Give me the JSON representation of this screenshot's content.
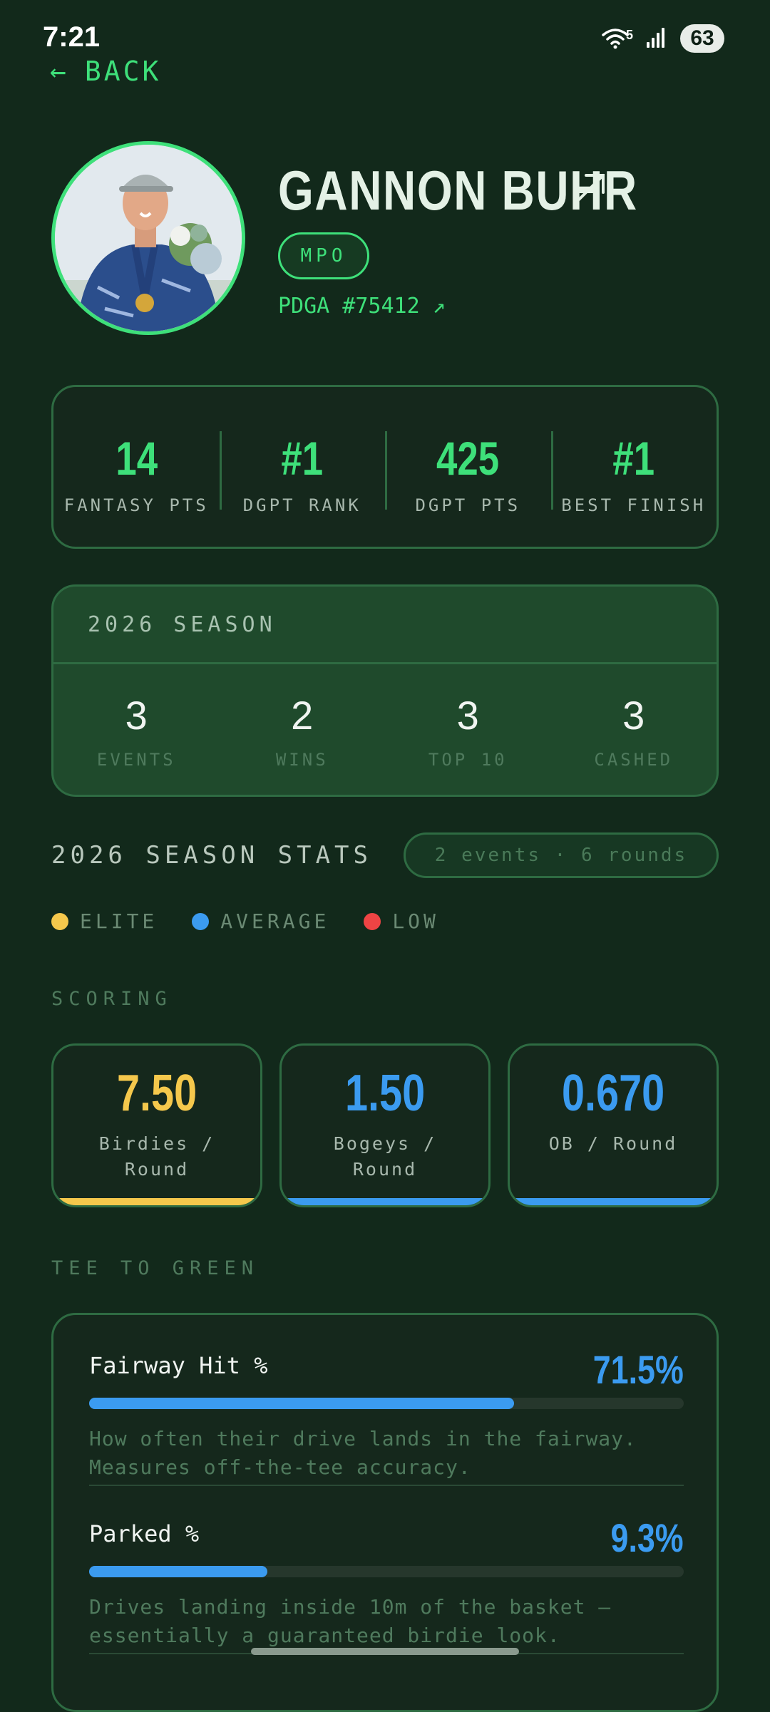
{
  "status_bar": {
    "time": "7:21",
    "wifi_badge": "5",
    "battery": "63"
  },
  "nav": {
    "back_label": "BACK"
  },
  "player": {
    "name": "GANNON BUHR",
    "division": "MPO",
    "pdga": "PDGA #75412 ↗",
    "name_link_icon": "arrow-up-right-icon"
  },
  "top_stats": [
    {
      "value": "14",
      "label": "FANTASY PTS"
    },
    {
      "value": "#1",
      "label": "DGPT RANK"
    },
    {
      "value": "425",
      "label": "DGPT PTS"
    },
    {
      "value": "#1",
      "label": "BEST FINISH"
    }
  ],
  "season": {
    "title": "2026 SEASON",
    "items": [
      {
        "value": "3",
        "label": "EVENTS"
      },
      {
        "value": "2",
        "label": "WINS"
      },
      {
        "value": "3",
        "label": "TOP 10"
      },
      {
        "value": "3",
        "label": "CASHED"
      }
    ]
  },
  "season_stats": {
    "title": "2026 SEASON STATS",
    "pill": "2 events · 6 rounds",
    "legend": [
      {
        "label": "ELITE",
        "color": "#f5c84c"
      },
      {
        "label": "AVERAGE",
        "color": "#3b9bf0"
      },
      {
        "label": "LOW",
        "color": "#ef4444"
      }
    ]
  },
  "scoring": {
    "title": "SCORING",
    "cards": [
      {
        "value": "7.50",
        "label": "Birdies / Round",
        "color": "#f5c84c"
      },
      {
        "value": "1.50",
        "label": "Bogeys / Round",
        "color": "#3b9bf0"
      },
      {
        "value": "0.670",
        "label": "OB / Round",
        "color": "#3b9bf0"
      }
    ]
  },
  "tee_to_green": {
    "title": "TEE TO GREEN",
    "metrics": [
      {
        "label": "Fairway Hit %",
        "value": "71.5%",
        "fill": 0.715,
        "description": "How often their drive lands in the fairway. Measures off-the-tee accuracy."
      },
      {
        "label": "Parked %",
        "value": "9.3%",
        "fill": 0.3,
        "description": "Drives landing inside 10m of the basket — essentially a guaranteed birdie look."
      }
    ]
  }
}
